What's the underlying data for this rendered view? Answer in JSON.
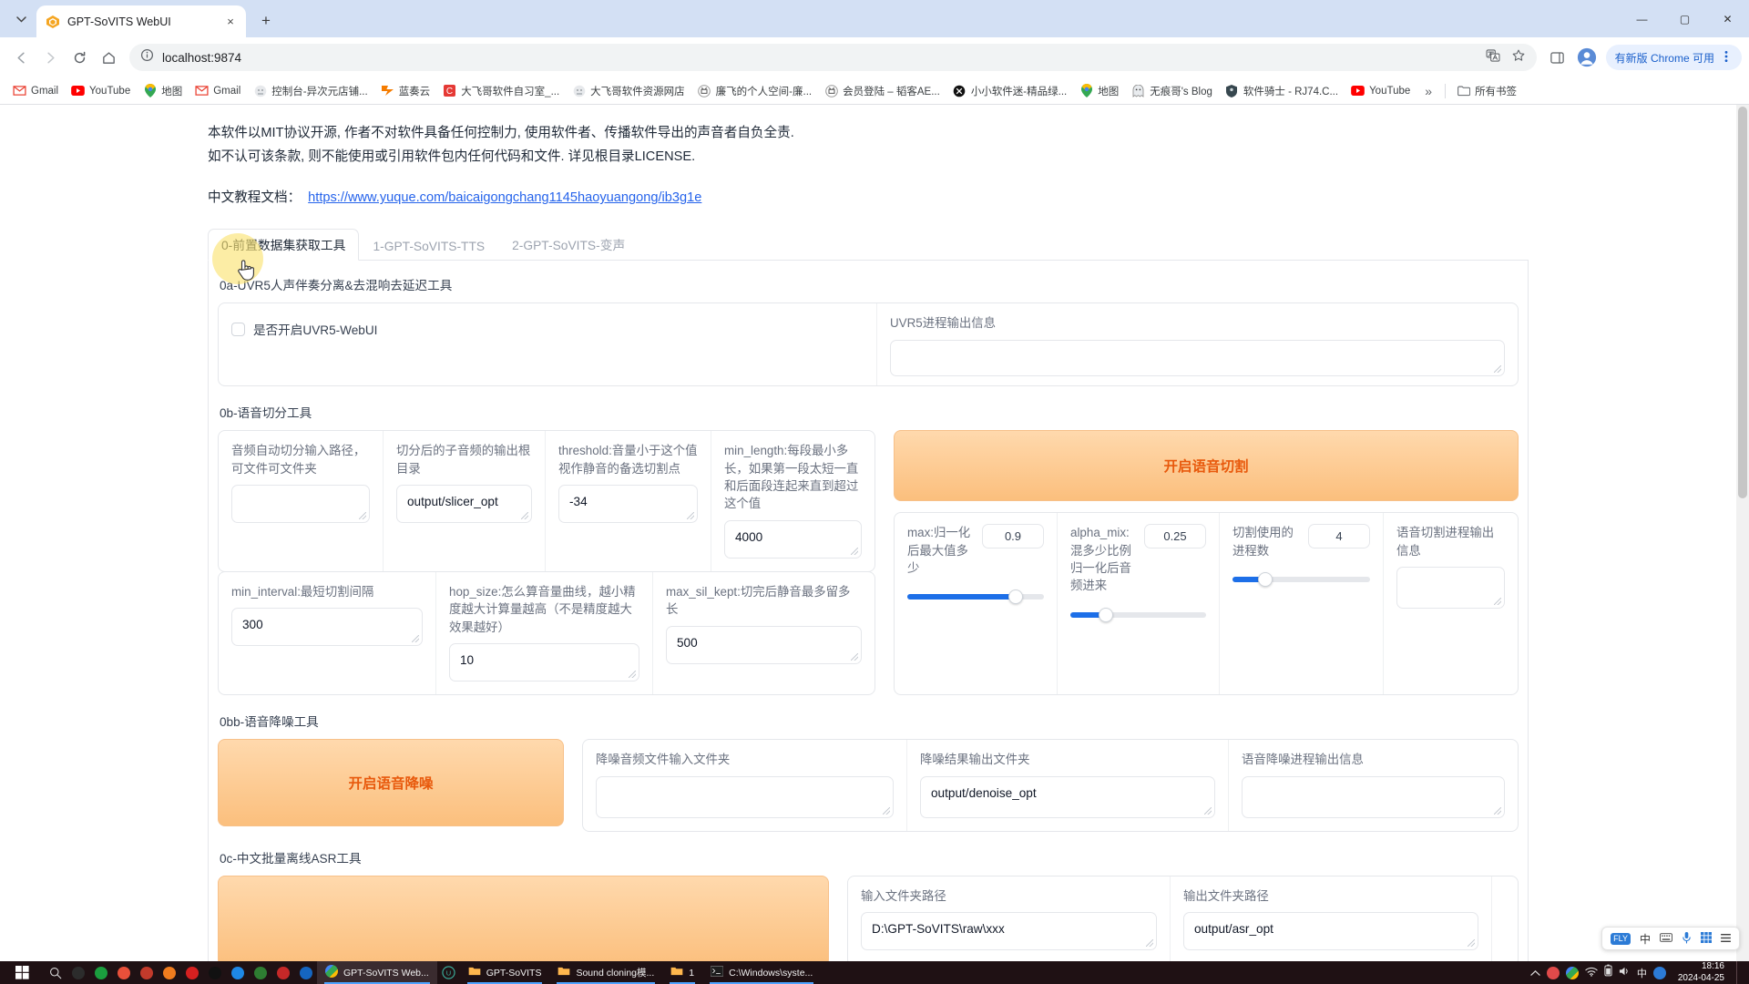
{
  "browser": {
    "tab": {
      "title": "GPT-SoVITS WebUI",
      "favicon": "gpt-sovits-icon",
      "close": "×"
    },
    "new_tab": "+",
    "window_controls": {
      "minimize": "—",
      "maximize": "▢",
      "close": "✕"
    },
    "nav": {
      "back": "←",
      "forward": "→",
      "reload": "⟳",
      "home": "⌂"
    },
    "omnibox": {
      "site_info_icon": "info-icon",
      "url": "localhost:9874",
      "translate_icon": "translate-icon",
      "bookmark_icon": "star-icon"
    },
    "toolbar_right": {
      "split_icon": "side-panel-icon",
      "profile_icon": "profile-avatar",
      "update_label": "有新版 Chrome 可用",
      "menu_icon": "three-dot-menu"
    },
    "bookmarks": [
      {
        "label": "Gmail",
        "icon": "gmail-icon"
      },
      {
        "label": "YouTube",
        "icon": "youtube-icon"
      },
      {
        "label": "地图",
        "icon": "maps-icon"
      },
      {
        "label": "Gmail",
        "icon": "gmail-icon"
      },
      {
        "label": "控制台-异次元店铺...",
        "icon": "generic-icon"
      },
      {
        "label": "蓝奏云",
        "icon": "lanzou-icon"
      },
      {
        "label": "大飞哥软件自习室_...",
        "icon": "c-icon"
      },
      {
        "label": "大飞哥软件资源网店",
        "icon": "generic-icon"
      },
      {
        "label": "廉飞的个人空间-廉...",
        "icon": "bilibili-icon"
      },
      {
        "label": "会员登陆 – 韬客AE...",
        "icon": "bilibili-icon"
      },
      {
        "label": "小小软件迷-精品绿...",
        "icon": "x-circle-icon"
      },
      {
        "label": "地图",
        "icon": "maps-icon"
      },
      {
        "label": "无痕哥's Blog",
        "icon": "ghost-icon"
      },
      {
        "label": "软件骑士 - RJ74.C...",
        "icon": "knight-icon"
      },
      {
        "label": "YouTube",
        "icon": "youtube-icon"
      }
    ],
    "bookmarks_overflow": "»",
    "all_bookmarks": "所有书签"
  },
  "page": {
    "notice_line1": "本软件以MIT协议开源, 作者不对软件具备任何控制力, 使用软件者、传播软件导出的声音者自负全责.",
    "notice_line2": "如不认可该条款, 则不能使用或引用软件包内任何代码和文件. 详见根目录LICENSE.",
    "tutorial_label": "中文教程文档：",
    "tutorial_url": "https://www.yuque.com/baicaigongchang1145haoyuangong/ib3g1e",
    "tabs": [
      {
        "label": "0-前置数据集获取工具",
        "active": true
      },
      {
        "label": "1-GPT-SoVITS-TTS",
        "active": false
      },
      {
        "label": "2-GPT-SoVITS-变声",
        "active": false
      }
    ],
    "uvr5": {
      "section_title": "0a-UVR5人声伴奏分离&去混响去延迟工具",
      "checkbox_label": "是否开启UVR5-WebUI",
      "checkbox_checked": false,
      "output_label": "UVR5进程输出信息",
      "output_value": ""
    },
    "slicer": {
      "section_title": "0b-语音切分工具",
      "input_path_label": "音频自动切分输入路径，可文件可文件夹",
      "input_path_value": "",
      "output_root_label": "切分后的子音频的输出根目录",
      "output_root_value": "output/slicer_opt",
      "threshold_label": "threshold:音量小于这个值视作静音的备选切割点",
      "threshold_value": "-34",
      "min_length_label": "min_length:每段最小多长，如果第一段太短一直和后面段连起来直到超过这个值",
      "min_length_value": "4000",
      "min_interval_label": "min_interval:最短切割间隔",
      "min_interval_value": "300",
      "hop_size_label": "hop_size:怎么算音量曲线，越小精度越大计算量越高（不是精度越大效果越好）",
      "hop_size_value": "10",
      "max_sil_kept_label": "max_sil_kept:切完后静音最多留多长",
      "max_sil_kept_value": "500",
      "start_button": "开启语音切割",
      "max_label": "max:归一化后最大值多少",
      "max_value": "0.9",
      "max_fill_pct": 79,
      "alpha_label": "alpha_mix:混多少比例归一化后音频进来",
      "alpha_value": "0.25",
      "alpha_fill_pct": 26,
      "threads_label": "切割使用的进程数",
      "threads_value": "4",
      "threads_fill_pct": 24,
      "progress_label": "语音切割进程输出信息",
      "progress_value": ""
    },
    "denoise": {
      "section_title": "0bb-语音降噪工具",
      "start_button": "开启语音降噪",
      "input_label": "降噪音频文件输入文件夹",
      "input_value": "",
      "output_label": "降噪结果输出文件夹",
      "output_value": "output/denoise_opt",
      "progress_label": "语音降噪进程输出信息",
      "progress_value": ""
    },
    "asr": {
      "section_title": "0c-中文批量离线ASR工具",
      "input_label": "输入文件夹路径",
      "input_value": "D:\\GPT-SoVITS\\raw\\xxx",
      "output_label": "输出文件夹路径",
      "output_value": "output/asr_opt"
    }
  },
  "ime": {
    "logo": "FLY",
    "mode": "中",
    "items": [
      "keyboard-icon",
      "mic-icon",
      "grid-icon",
      "menu-icon"
    ]
  },
  "taskbar": {
    "start": "windows-start-icon",
    "search": "search-icon",
    "quick_icons": [
      "k-icon",
      "app-icon",
      "firefox-icon",
      "record-icon",
      "q-icon",
      "opera-icon",
      "browser-icon",
      "chat-icon",
      "list-icon",
      "book-icon",
      "shield-icon"
    ],
    "windows": [
      {
        "label": "GPT-SoVITS Web...",
        "icon": "chrome-icon",
        "active": true
      },
      {
        "label": "GPT-SoVITS",
        "icon": "folder-icon",
        "active": false
      },
      {
        "label": "Sound cloning模...",
        "icon": "folder-icon",
        "active": false
      },
      {
        "label": "1",
        "icon": "folder-icon",
        "active": false
      },
      {
        "label": "C:\\Windows\\syste...",
        "icon": "terminal-icon",
        "active": false
      }
    ],
    "circle_u": "U",
    "tray": [
      "chevron-up-icon",
      "record-icon",
      "chrome-icon",
      "wifi-icon",
      "battery-icon",
      "volume-icon",
      "ime-icon",
      "cloud-icon"
    ],
    "clock_time": "18:16",
    "clock_date": "2024-04-25",
    "show_desktop": "show-desktop"
  }
}
